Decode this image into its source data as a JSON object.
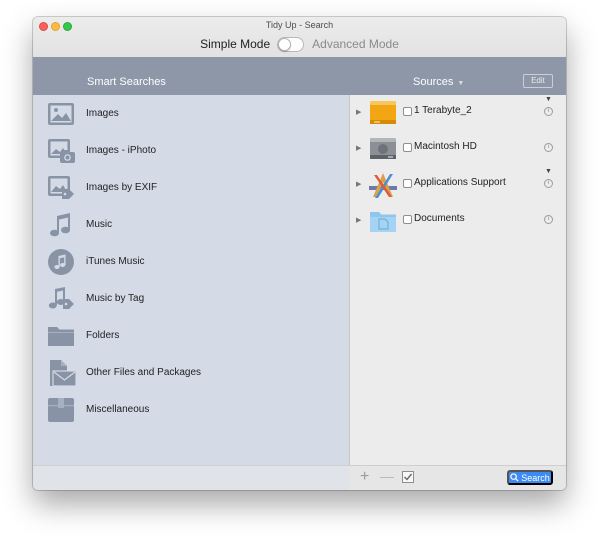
{
  "window": {
    "title": "Tidy Up - Search"
  },
  "mode": {
    "simple_label": "Simple Mode",
    "advanced_label": "Advanced Mode",
    "selected": "Simple Mode"
  },
  "header": {
    "smart_searches_label": "Smart Searches",
    "sources_label": "Sources",
    "edit_label": "Edit"
  },
  "smart_searches": [
    {
      "label": "Images",
      "icon": "image-icon"
    },
    {
      "label": "Images - iPhoto",
      "icon": "iphoto-icon"
    },
    {
      "label": "Images by EXIF",
      "icon": "exif-icon"
    },
    {
      "label": "Music",
      "icon": "music-note-icon"
    },
    {
      "label": "iTunes Music",
      "icon": "itunes-icon"
    },
    {
      "label": "Music by Tag",
      "icon": "music-tag-icon"
    },
    {
      "label": "Folders",
      "icon": "folder-icon"
    },
    {
      "label": "Other Files and Packages",
      "icon": "document-icon"
    },
    {
      "label": "Miscellaneous",
      "icon": "box-icon"
    }
  ],
  "sources": [
    {
      "label": "1 Terabyte_2",
      "icon": "external-drive-icon",
      "checked": false
    },
    {
      "label": "Macintosh HD",
      "icon": "internal-drive-icon",
      "checked": false
    },
    {
      "label": "Applications Support",
      "icon": "applications-icon",
      "checked": false
    },
    {
      "label": "Documents",
      "icon": "documents-folder-icon",
      "checked": false
    }
  ],
  "toolbar": {
    "add_label": "+",
    "remove_label": "—",
    "search_label": "Search"
  },
  "colors": {
    "header_band": "#8d97a8",
    "left_pane": "#d4dbe6",
    "icon_gray": "#8894a6",
    "search_button": "#3d8bf2",
    "external_drive": "#f3a614",
    "folder_blue": "#8ec6ee"
  }
}
